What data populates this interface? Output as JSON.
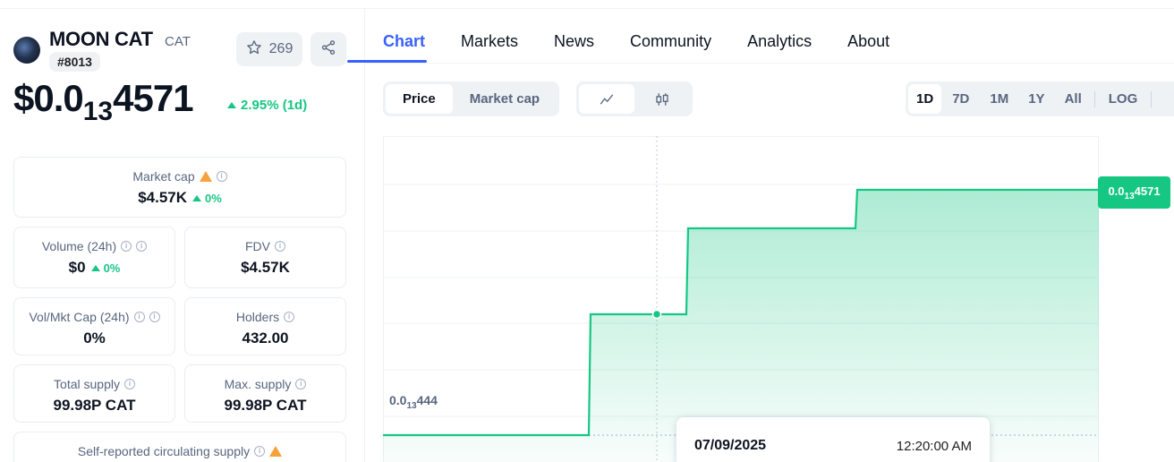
{
  "coin": {
    "name": "MOON CAT",
    "symbol": "CAT",
    "rank": "#8013",
    "watchlist_count": "269",
    "price_prefix": "$0.0",
    "price_zeros": "13",
    "price_digits": "4571",
    "price_change": "2.95% (1d)"
  },
  "stats": {
    "market_cap": {
      "label": "Market cap",
      "value": "$4.57K",
      "change": "0%"
    },
    "volume": {
      "label": "Volume (24h)",
      "value": "$0",
      "change": "0%"
    },
    "fdv": {
      "label": "FDV",
      "value": "$4.57K"
    },
    "vol_mkt_cap": {
      "label": "Vol/Mkt Cap (24h)",
      "value": "0%"
    },
    "holders": {
      "label": "Holders",
      "value": "432.00"
    },
    "total_supply": {
      "label": "Total supply",
      "value": "99.98P CAT"
    },
    "max_supply": {
      "label": "Max. supply",
      "value": "99.98P CAT"
    },
    "self_reported": {
      "label": "Self-reported circulating supply"
    }
  },
  "tabs": [
    "Chart",
    "Markets",
    "News",
    "Community",
    "Analytics",
    "About"
  ],
  "chart_controls": {
    "mode": [
      "Price",
      "Market cap"
    ],
    "ranges": [
      "1D",
      "7D",
      "1M",
      "1Y",
      "All"
    ],
    "log_label": "LOG"
  },
  "chart_overlay": {
    "current_tag_prefix": "0.0",
    "current_tag_zeros": "13",
    "current_tag_digits": "4571",
    "low_label_prefix": "0.0",
    "low_label_zeros": "13",
    "low_label_digits": "444",
    "tooltip_date": "07/09/2025",
    "tooltip_time": "12:20:00 AM"
  },
  "colors": {
    "accent": "#3861fb",
    "up": "#16c784",
    "warn": "#f6a23c"
  },
  "icons": [
    "star-icon",
    "share-icon",
    "line-chart-icon",
    "candlestick-icon",
    "info-icon",
    "warning-icon"
  ]
}
